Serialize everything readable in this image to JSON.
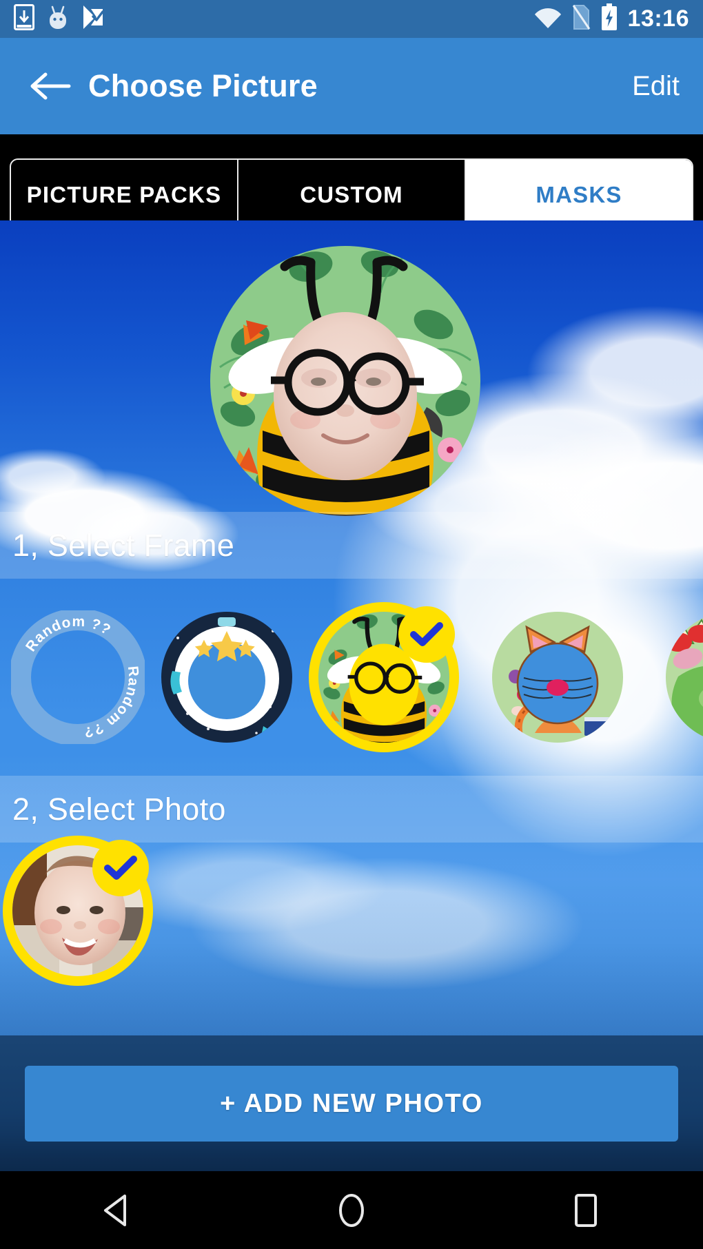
{
  "status_bar": {
    "icons": [
      "download-icon",
      "android-head-icon",
      "checkmark-app-icon"
    ],
    "right_icons": [
      "wifi-icon",
      "sim-card-icon",
      "battery-charging-icon"
    ],
    "clock": "13:16",
    "background_color": "#2d6ca8"
  },
  "app_bar": {
    "back_icon": "arrow-left-icon",
    "title": "Choose Picture",
    "action_label": "Edit",
    "background_color": "#3787d1"
  },
  "tabs": {
    "items": [
      {
        "label": "PICTURE PACKS",
        "active": false
      },
      {
        "label": "CUSTOM",
        "active": false
      },
      {
        "label": "MASKS",
        "active": true
      }
    ],
    "active_text_color": "#2f7dc6",
    "inactive_text_color": "#ffffff"
  },
  "preview": {
    "frame_name": "bee-tropical-mask",
    "photo_name": "baby-photo",
    "description": "Round preview: baby face inside a bee costume mask on a tropical leaf circle over a blue sky wallpaper"
  },
  "sections": [
    {
      "id": "select-frame",
      "label": "1, Select Frame"
    },
    {
      "id": "select-photo",
      "label": "2, Select Photo"
    }
  ],
  "frames": [
    {
      "name": "random-frame",
      "label": "Random ??",
      "selected": false,
      "kind": "random-ring"
    },
    {
      "name": "astronaut-frame",
      "label": "",
      "selected": false,
      "kind": "astronaut"
    },
    {
      "name": "bee-frame",
      "label": "",
      "selected": true,
      "kind": "bee"
    },
    {
      "name": "cat-frame",
      "label": "",
      "selected": false,
      "kind": "cat"
    },
    {
      "name": "dino-frame",
      "label": "",
      "selected": false,
      "kind": "dino"
    }
  ],
  "photos": [
    {
      "name": "baby-photo",
      "selected": true
    }
  ],
  "footer": {
    "add_photo_label": "+ ADD NEW PHOTO",
    "button_color": "#3787d1"
  },
  "nav_bar": {
    "back_icon": "triangle-back-icon",
    "home_icon": "circle-home-icon",
    "recents_icon": "square-recents-icon",
    "background_color": "#000000"
  },
  "colors": {
    "accent_blue": "#3787d1",
    "status_blue": "#2d6ca8",
    "selection_yellow": "#FFE100",
    "check_blue": "#1F35D6"
  }
}
